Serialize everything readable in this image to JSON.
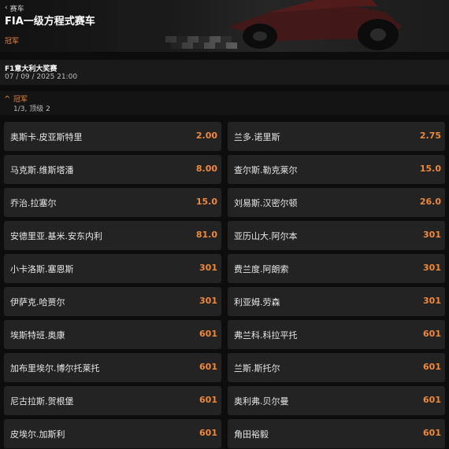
{
  "header": {
    "back_label": "赛车",
    "title": "FIA一级方程式赛车",
    "tab": "冠军"
  },
  "event": {
    "name": "F1意大利大奖赛",
    "datetime": "07 / 09 / 2025 21:00"
  },
  "market": {
    "name": "冠军",
    "subtitle": "1/3, 顶级 2"
  },
  "colors": {
    "accent": "#f0883a",
    "cell_bg": "#232323",
    "page_bg": "#0d0d0d"
  },
  "selections": [
    {
      "name": "奥斯卡.皮亚斯特里",
      "odds": "2.00"
    },
    {
      "name": "兰多.诺里斯",
      "odds": "2.75"
    },
    {
      "name": "马克斯.维斯塔潘",
      "odds": "8.00"
    },
    {
      "name": "查尔斯.勒克莱尔",
      "odds": "15.0"
    },
    {
      "name": "乔治.拉塞尔",
      "odds": "15.0"
    },
    {
      "name": "刘易斯.汉密尔顿",
      "odds": "26.0"
    },
    {
      "name": "安德里亚.基米.安东内利",
      "odds": "81.0"
    },
    {
      "name": "亚历山大.阿尔本",
      "odds": "301"
    },
    {
      "name": "小卡洛斯.塞恩斯",
      "odds": "301"
    },
    {
      "name": "费兰度.阿朗索",
      "odds": "301"
    },
    {
      "name": "伊萨克.哈贾尔",
      "odds": "301"
    },
    {
      "name": "利亚姆.劳森",
      "odds": "301"
    },
    {
      "name": "埃斯特班.奥康",
      "odds": "601"
    },
    {
      "name": "弗兰科.科拉平托",
      "odds": "601"
    },
    {
      "name": "加布里埃尔.博尔托莱托",
      "odds": "601"
    },
    {
      "name": "兰斯.斯托尔",
      "odds": "601"
    },
    {
      "name": "尼古拉斯.贺根堡",
      "odds": "601"
    },
    {
      "name": "奥利弗.贝尔曼",
      "odds": "601"
    },
    {
      "name": "皮埃尔.加斯利",
      "odds": "601"
    },
    {
      "name": "角田裕毅",
      "odds": "601"
    }
  ]
}
